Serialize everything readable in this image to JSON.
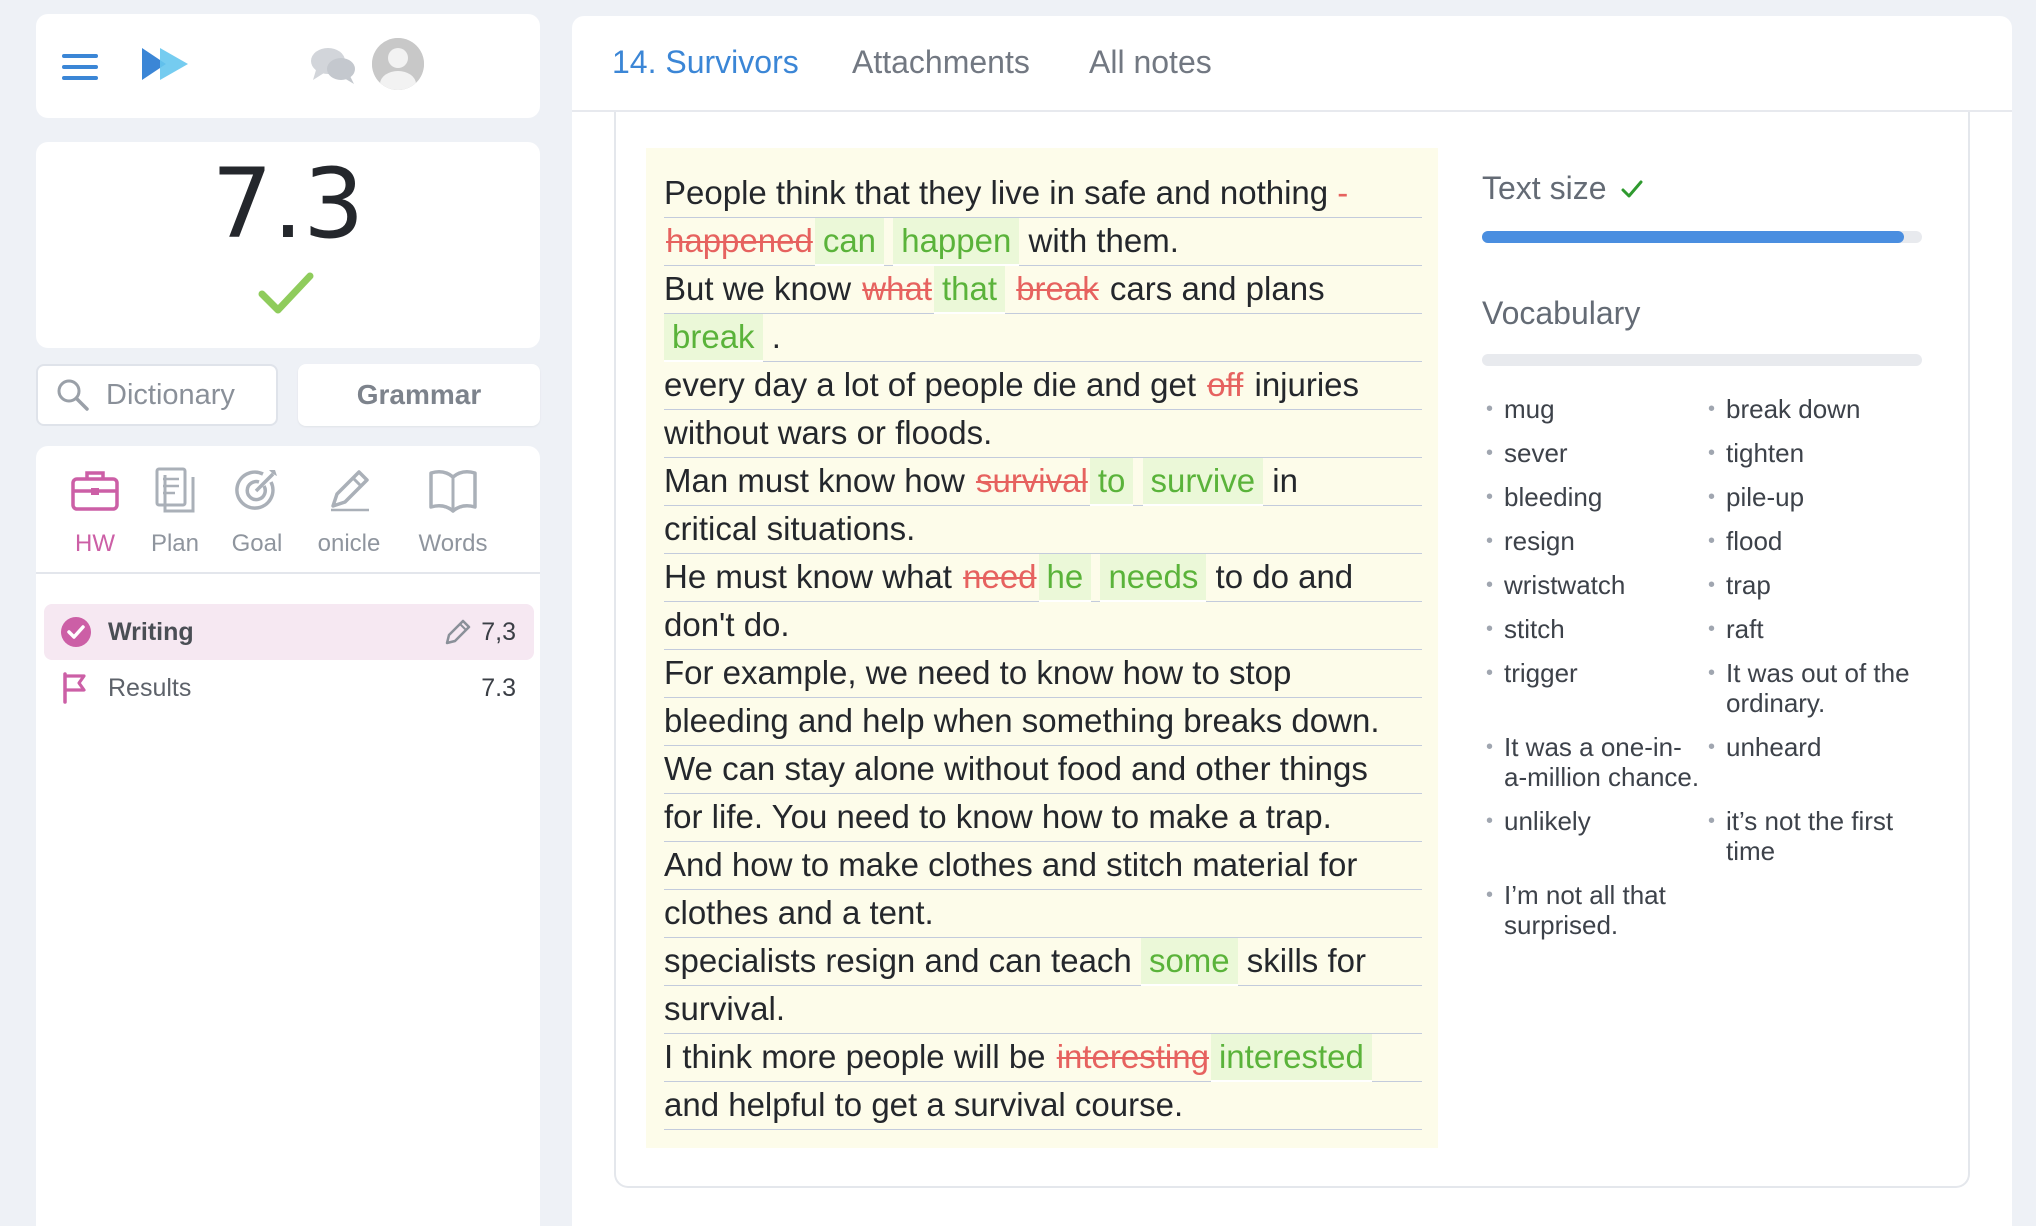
{
  "main_tabs": [
    "14. Survivors",
    "Attachments",
    "All notes"
  ],
  "score": "7.3",
  "dictionary_label": "Dictionary",
  "grammar_label": "Grammar",
  "nav": [
    {
      "label": "HW",
      "icon": "briefcase-icon",
      "active": true
    },
    {
      "label": "Plan",
      "icon": "document-icon",
      "active": false
    },
    {
      "label": "Goal",
      "icon": "target-icon",
      "active": false
    },
    {
      "label": "onicle",
      "icon": "pencil-icon",
      "active": false
    },
    {
      "label": "Words",
      "icon": "book-icon",
      "active": false
    }
  ],
  "tasks": [
    {
      "label": "Writing",
      "score": "7,3",
      "icon": "check-circle-icon"
    },
    {
      "label": "Results",
      "score": "7.3",
      "icon": "flag-icon"
    }
  ],
  "text_size": {
    "label": "Text size",
    "level_fraction": 0.96
  },
  "vocabulary": {
    "label": "Vocabulary",
    "items": [
      "mug",
      "break down",
      "sever",
      "tighten",
      "bleeding",
      "pile-up",
      "resign",
      "flood",
      "wristwatch",
      "trap",
      "stitch",
      "raft",
      "trigger",
      "It was out of the ordinary.",
      "It was a one-in-a-million chance.",
      "unheard",
      "unlikely",
      "it’s not the first time",
      "I’m not all that surprised.",
      ""
    ]
  },
  "essay_lines": [
    [
      {
        "t": "People think that they live in safe and nothing "
      },
      {
        "t": "-",
        "k": "dash"
      }
    ],
    [
      {
        "t": "happened",
        "k": "del"
      },
      {
        "t": "can",
        "k": "ins"
      },
      {
        "t": " "
      },
      {
        "t": "happen",
        "k": "ins"
      },
      {
        "t": " with them."
      }
    ],
    [
      {
        "t": "But we know "
      },
      {
        "t": "what",
        "k": "del"
      },
      {
        "t": "that",
        "k": "ins"
      },
      {
        "t": " "
      },
      {
        "t": "break",
        "k": "del"
      },
      {
        "t": " cars and plans "
      }
    ],
    [
      {
        "t": "break",
        "k": "ins"
      },
      {
        "t": " ."
      }
    ],
    [
      {
        "t": "every day a lot of people die and get "
      },
      {
        "t": "off",
        "k": "del"
      },
      {
        "t": " injuries"
      }
    ],
    [
      {
        "t": "without wars or floods."
      }
    ],
    [
      {
        "t": "Man must know how "
      },
      {
        "t": "survival",
        "k": "del"
      },
      {
        "t": "to",
        "k": "ins"
      },
      {
        "t": " "
      },
      {
        "t": "survive",
        "k": "ins"
      },
      {
        "t": " in"
      }
    ],
    [
      {
        "t": "critical situations."
      }
    ],
    [
      {
        "t": "He must know what "
      },
      {
        "t": "need",
        "k": "del"
      },
      {
        "t": "he",
        "k": "ins"
      },
      {
        "t": " "
      },
      {
        "t": "needs",
        "k": "ins"
      },
      {
        "t": " to do and"
      }
    ],
    [
      {
        "t": "don't do."
      }
    ],
    [
      {
        "t": "For example, we need to know how to stop"
      }
    ],
    [
      {
        "t": "bleeding and help when something breaks down."
      }
    ],
    [
      {
        "t": "We can stay alone without food and other things"
      }
    ],
    [
      {
        "t": "for life. You need to know how to make a trap."
      }
    ],
    [
      {
        "t": "And how to make clothes and stitch material for"
      }
    ],
    [
      {
        "t": "clothes and a tent."
      }
    ],
    [
      {
        "t": "specialists resign and can teach "
      },
      {
        "t": "some",
        "k": "ins"
      },
      {
        "t": " skills for"
      }
    ],
    [
      {
        "t": "survival."
      }
    ],
    [
      {
        "t": "I think more people will be "
      },
      {
        "t": "interesting",
        "k": "del"
      },
      {
        "t": "interested",
        "k": "ins"
      }
    ],
    [
      {
        "t": "and helpful to get a survival course."
      }
    ]
  ],
  "colors": {
    "accent": "#3b86d6",
    "pink": "#cc5fa6",
    "correct": "#5ab33a",
    "error": "#e6625f",
    "essay_bg": "#fdfcea"
  }
}
